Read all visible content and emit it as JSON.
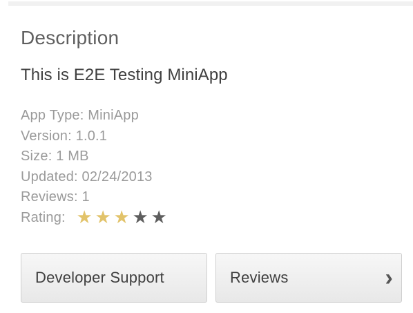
{
  "description_section": {
    "title": "Description",
    "app_description": "This is E2E Testing MiniApp",
    "details": {
      "app_type": "App Type: MiniApp",
      "version": "Version: 1.0.1",
      "size": "Size: 1 MB",
      "updated": "Updated: 02/24/2013",
      "reviews": "Reviews: 1",
      "rating_label": "Rating:"
    },
    "rating": {
      "value": 3,
      "max": 5,
      "filled_color": "#e2c36a",
      "empty_color": "#5e5e5e",
      "star_glyph": "★"
    }
  },
  "actions": {
    "developer_support_label": "Developer Support",
    "reviews_label": "Reviews",
    "chevron_icon": "chevron-right-icon"
  }
}
